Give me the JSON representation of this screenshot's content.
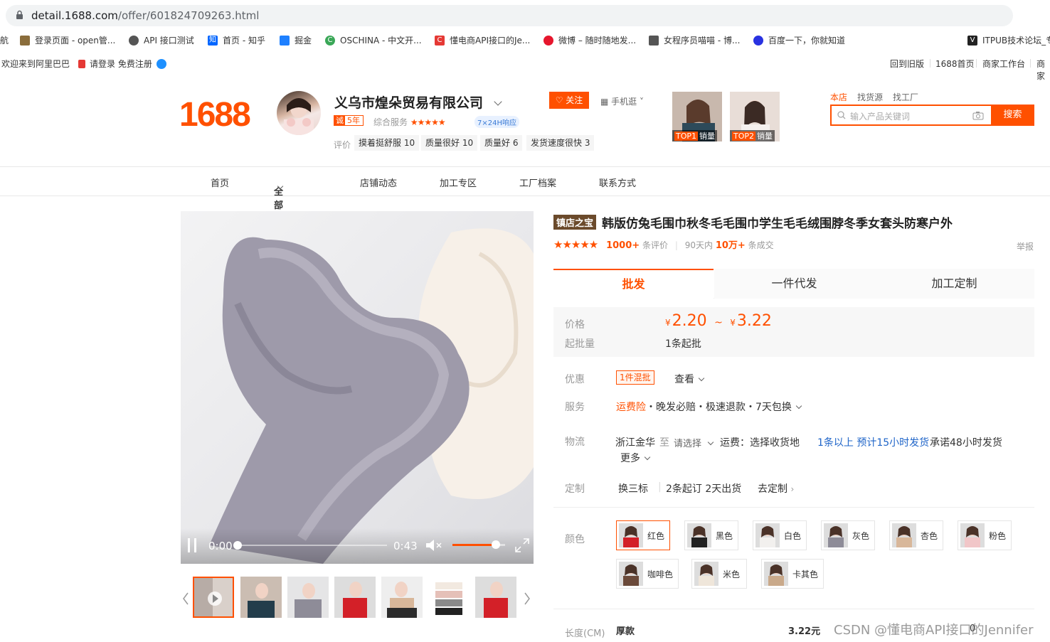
{
  "browser": {
    "url_host": "detail.1688.com",
    "url_path": "/offer/601824709263.html",
    "bookmarks": [
      {
        "label": "航",
        "color": "#666"
      },
      {
        "label": "登录页面 - open管...",
        "color": "#8a6d3b"
      },
      {
        "label": "API 接口测试",
        "color": "#555"
      },
      {
        "label": "首页 - 知乎",
        "color": "#0066ff"
      },
      {
        "label": "掘金",
        "color": "#1e80ff"
      },
      {
        "label": "OSCHINA - 中文开...",
        "color": "#3aa757"
      },
      {
        "label": "懂电商API接口的Je...",
        "color": "#e53935"
      },
      {
        "label": "微博 – 随时随地发...",
        "color": "#e6162d"
      },
      {
        "label": "女程序员喵喵 - 博...",
        "color": "#555"
      },
      {
        "label": "百度一下，你就知道",
        "color": "#2932e1"
      },
      {
        "label": "ITPUB技术论坛_专",
        "color": "#222"
      }
    ]
  },
  "topbar": {
    "welcome": "欢迎来到阿里巴巴",
    "login": "请登录 免费注册",
    "links": [
      "回到旧版",
      "1688首页",
      "商家工作台",
      "商家"
    ]
  },
  "header": {
    "logo": "1688",
    "company": "义乌市煌朵贸易有限公司",
    "cheng": "诚",
    "years": "5年",
    "service_label": "综合服务",
    "service_stars": "★★★★★",
    "response": "7×24H响应",
    "follow": "关注",
    "mobile": "手机逛",
    "rating_label": "评价",
    "rating_tags": [
      "摸着挺舒服 10",
      "质量很好 10",
      "质量好 6",
      "发货速度很快 3"
    ],
    "top_thumbs": [
      {
        "rank": "TOP1",
        "label": "销量"
      },
      {
        "rank": "TOP2",
        "label": "销量"
      }
    ],
    "search_tabs": [
      "本店",
      "找货源",
      "找工厂"
    ],
    "search_placeholder": "输入产品关键词",
    "search_button": "搜索"
  },
  "nav": [
    "首页",
    "全部商品",
    "店铺动态",
    "加工专区",
    "工厂档案",
    "联系方式"
  ],
  "video": {
    "current": "0:00",
    "duration": "0:43",
    "volume": 0.82,
    "progress": 0.0
  },
  "product": {
    "badge": "镇店之宝",
    "title": "韩版仿兔毛围巾秋冬毛毛围巾学生毛毛绒围脖冬季女套头防寒户外",
    "review_count": "1000+",
    "review_suffix": "条评价",
    "period": "90天内",
    "deals": "10万+",
    "deals_suffix": "条成交",
    "report": "举报",
    "modes": [
      "批发",
      "一件代发",
      "加工定制"
    ],
    "price_label": "价格",
    "price_low": "2.20",
    "price_sep": "~",
    "price_high": "3.22",
    "currency": "¥",
    "moq_label": "起批量",
    "moq": "1条起批",
    "promo_label": "优惠",
    "promo_tag": "1件混批",
    "promo_view": "查看",
    "service_label": "服务",
    "service_insure": "运费险",
    "service_items": "・晚发必赔・极速退款・7天包换",
    "logistics_label": "物流",
    "origin": "浙江金华",
    "to": "至",
    "dest": "请选择",
    "freight": "运费：选择收货地",
    "ship_time": "1条以上 预计15小时发货",
    "promise": "承诺48小时发货",
    "more": "更多",
    "custom_label": "定制",
    "custom_items": [
      "换三标",
      "2条起订 2天出货"
    ],
    "custom_link": "去定制",
    "color_label": "颜色",
    "colors": [
      "红色",
      "黑色",
      "白色",
      "灰色",
      "杏色",
      "粉色",
      "咖啡色",
      "米色",
      "卡其色"
    ],
    "length_label": "长度(CM)",
    "length_value": "厚款",
    "length_price": "3.22元",
    "length_stock": "0",
    "watermark": "CSDN @懂电商API接口的Jennifer"
  }
}
